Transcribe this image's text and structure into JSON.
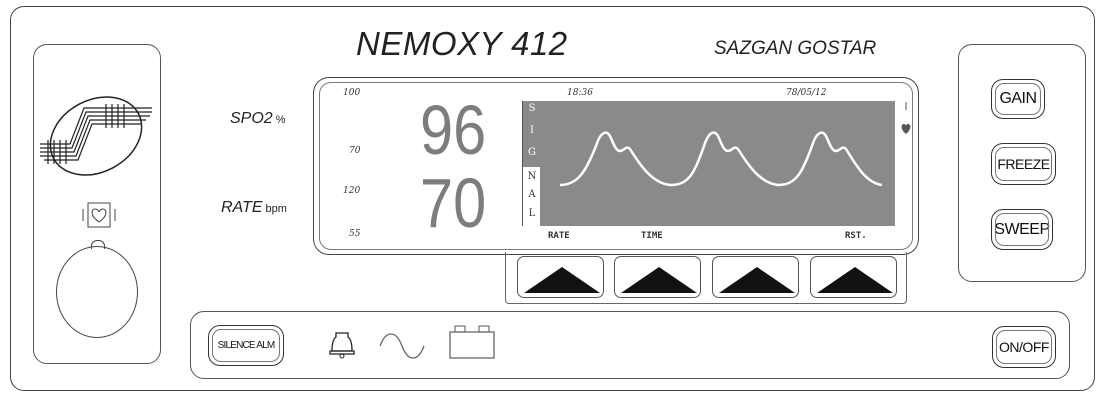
{
  "device": {
    "model": "NEMOXY 412",
    "manufacturer": "SAZGAN GOSTAR"
  },
  "parameters": {
    "spo2": {
      "label": "SPO2",
      "unit": "%",
      "value": "96",
      "alarm_high": "100",
      "alarm_low": "70"
    },
    "rate": {
      "label": "RATE",
      "unit": "bpm",
      "value": "70",
      "alarm_high": "120",
      "alarm_low": "55"
    }
  },
  "display": {
    "time": "18:36",
    "date": "78/05/12",
    "signal_strip_top": [
      "S",
      "I",
      "G"
    ],
    "signal_strip_bottom": [
      "N",
      "A",
      "L"
    ],
    "soft_key_labels": [
      "RATE",
      "TIME",
      "",
      "RST."
    ],
    "waveform_color": "#ffffff",
    "screen_color": "#8a8a8a"
  },
  "buttons": {
    "gain": "GAIN",
    "freeze": "FREEZE",
    "sweep": "SWEEP",
    "on_off": "ON/OFF",
    "silence_alarm": "SILENCE ALM"
  },
  "icons": [
    "company-logo-icon",
    "heart-icon",
    "bell-icon",
    "sine-wave-icon",
    "battery-icon",
    "arrow-up-icon"
  ]
}
